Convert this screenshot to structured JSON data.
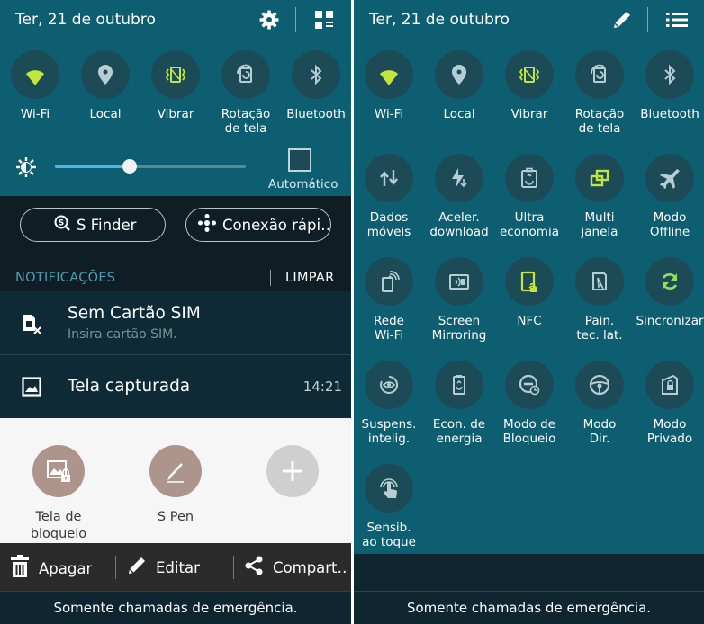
{
  "left": {
    "header": {
      "date": "Ter, 21 de outubro",
      "settings_icon": "gear-icon",
      "grid_icon": "grid-edit-icon"
    },
    "toggles": [
      {
        "label": "Wi-Fi",
        "icon": "wifi-icon",
        "state": "on"
      },
      {
        "label": "Local",
        "icon": "location-icon",
        "state": "off"
      },
      {
        "label": "Vibrar",
        "icon": "vibrate-icon",
        "state": "on"
      },
      {
        "label": "Rotação\nde tela",
        "icon": "rotation-icon",
        "state": "off"
      },
      {
        "label": "Bluetooth",
        "icon": "bluetooth-icon",
        "state": "off"
      }
    ],
    "brightness": {
      "level": 0.39,
      "auto_label": "Automático",
      "auto_checked": false
    },
    "shortcuts": [
      {
        "label": "S Finder",
        "icon": "sfinder-icon"
      },
      {
        "label": "Conexão rápi…",
        "icon": "quick-connect-icon"
      }
    ],
    "notifications_header": {
      "title": "NOTIFICAÇÕES",
      "clear": "LIMPAR"
    },
    "notifications": [
      {
        "title": "Sem Cartão SIM",
        "subtitle": "Insira cartão SIM.",
        "time": "",
        "icon": "no-sim-icon"
      },
      {
        "title": "Tela capturada",
        "subtitle": "",
        "time": "14:21",
        "icon": "screenshot-icon"
      }
    ],
    "sheet_items": [
      {
        "label": "Tela de\nbloqueio",
        "icon": "lockscreen-icon"
      },
      {
        "label": "S Pen",
        "icon": "spen-icon"
      },
      {
        "label": "",
        "icon": "plus-icon"
      }
    ],
    "actions": [
      {
        "label": "Apagar",
        "icon": "trash-icon"
      },
      {
        "label": "Editar",
        "icon": "pencil-icon"
      },
      {
        "label": "Compart…",
        "icon": "share-icon"
      }
    ],
    "footer": "Somente chamadas de emergência."
  },
  "right": {
    "header": {
      "date": "Ter, 21 de outubro",
      "edit_icon": "pencil-icon",
      "list_icon": "list-icon"
    },
    "toggles": [
      {
        "label": "Wi-Fi",
        "icon": "wifi-icon",
        "state": "on"
      },
      {
        "label": "Local",
        "icon": "location-icon",
        "state": "off"
      },
      {
        "label": "Vibrar",
        "icon": "vibrate-icon",
        "state": "on"
      },
      {
        "label": "Rotação\nde tela",
        "icon": "rotation-icon",
        "state": "off"
      },
      {
        "label": "Bluetooth",
        "icon": "bluetooth-icon",
        "state": "off"
      },
      {
        "label": "Dados\nmóveis",
        "icon": "mobile-data-icon",
        "state": "off"
      },
      {
        "label": "Aceler.\ndownload",
        "icon": "download-booster-icon",
        "state": "off"
      },
      {
        "label": "Ultra\neconomia",
        "icon": "ultra-power-saving-icon",
        "state": "off"
      },
      {
        "label": "Multi\njanela",
        "icon": "multi-window-icon",
        "state": "on"
      },
      {
        "label": "Modo\nOffline",
        "icon": "airplane-icon",
        "state": "off"
      },
      {
        "label": "Rede\nWi-Fi",
        "icon": "wifi-hotspot-icon",
        "state": "off"
      },
      {
        "label": "Screen\nMirroring",
        "icon": "screen-mirroring-icon",
        "state": "off"
      },
      {
        "label": "NFC",
        "icon": "nfc-icon",
        "state": "on"
      },
      {
        "label": "Pain.\ntec. lat.",
        "icon": "side-key-panel-icon",
        "state": "off"
      },
      {
        "label": "Sincronizar",
        "icon": "sync-icon",
        "state": "active"
      },
      {
        "label": "Suspens.\nintelig.",
        "icon": "smart-stay-icon",
        "state": "off"
      },
      {
        "label": "Econ. de\nenergia",
        "icon": "power-saving-icon",
        "state": "off"
      },
      {
        "label": "Modo de\nBloqueio",
        "icon": "blocking-mode-icon",
        "state": "off"
      },
      {
        "label": "Modo\nDir.",
        "icon": "driving-mode-icon",
        "state": "off"
      },
      {
        "label": "Modo\nPrivado",
        "icon": "private-mode-icon",
        "state": "off"
      },
      {
        "label": "Sensib.\nao toque",
        "icon": "touch-sensitivity-icon",
        "state": "off"
      }
    ],
    "footer": "Somente chamadas de emergência."
  },
  "colors": {
    "panel_teal": "#0e5e72",
    "toggle_on": "#c2e63c",
    "toggle_off": "#b5cdd3",
    "sync_active": "#8ee05a",
    "notif_dark": "#0d2a36",
    "sheet_bg": "#f6f6f6"
  }
}
